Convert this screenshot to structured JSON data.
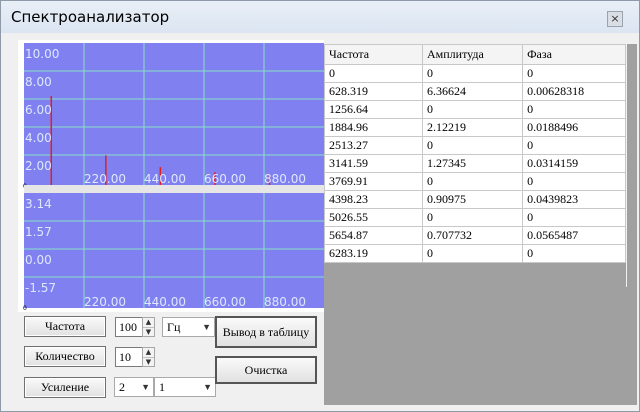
{
  "window": {
    "title": "Спектроанализатор",
    "close_glyph": "×"
  },
  "colors": {
    "plot_bg": "#8080f0",
    "grid": "#88e0c8",
    "spike": "#e02020",
    "label": "#dde8ff"
  },
  "plots": {
    "amplitude_yticks": [
      "10.00",
      "8.00",
      "6.00",
      "4.00",
      "2.00"
    ],
    "amplitude_xticks": [
      "220.00",
      "440.00",
      "660.00",
      "880.00"
    ],
    "amplitude_origin": "0",
    "phase_yticks": [
      "3.14",
      "1.57",
      "0.00",
      "-1.57"
    ],
    "phase_xticks": [
      "220.00",
      "440.00",
      "660.00",
      "880.00"
    ],
    "phase_origin": "0"
  },
  "chart_data": {
    "type": "bar",
    "x": [
      0,
      100,
      200,
      300,
      400,
      500,
      600,
      700,
      800,
      900,
      1000
    ],
    "values": [
      0,
      6.36624,
      0,
      2.12219,
      0,
      1.27345,
      0,
      0.90975,
      0,
      0.707732,
      0
    ],
    "ylim": [
      0,
      10
    ],
    "xlim": [
      0,
      1100
    ]
  },
  "table": {
    "headers": [
      "Частота",
      "Амплитуда",
      "Фаза"
    ],
    "rows": [
      [
        "0",
        "0",
        "0"
      ],
      [
        "628.319",
        "6.36624",
        "0.00628318"
      ],
      [
        "1256.64",
        "0",
        "0"
      ],
      [
        "1884.96",
        "2.12219",
        "0.0188496"
      ],
      [
        "2513.27",
        "0",
        "0"
      ],
      [
        "3141.59",
        "1.27345",
        "0.0314159"
      ],
      [
        "3769.91",
        "0",
        "0"
      ],
      [
        "4398.23",
        "0.90975",
        "0.0439823"
      ],
      [
        "5026.55",
        "0",
        "0"
      ],
      [
        "5654.87",
        "0.707732",
        "0.0565487"
      ],
      [
        "6283.19",
        "0",
        "0"
      ]
    ]
  },
  "controls": {
    "frequency_button": "Частота",
    "frequency_value": "100",
    "frequency_unit": "Гц",
    "count_button": "Количество",
    "count_value": "10",
    "gain_button": "Усиление",
    "gain_value_1": "2",
    "gain_value_2": "1",
    "output_button": "Вывод в таблицу",
    "clear_button": "Очистка"
  }
}
